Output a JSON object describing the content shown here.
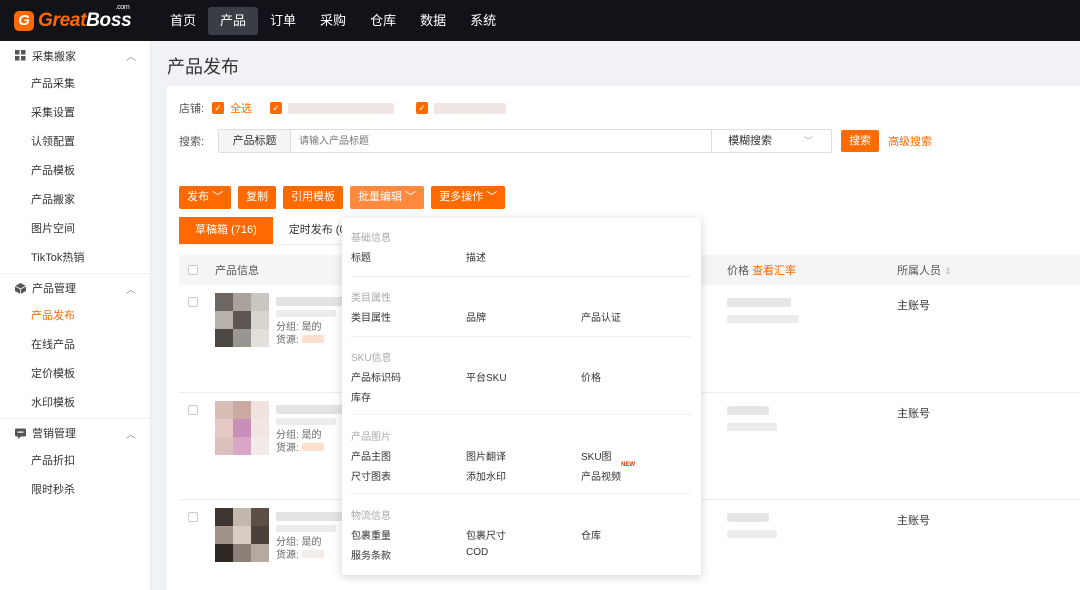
{
  "brand": {
    "logo_mark": "G",
    "name_part1": "Great",
    "name_part2": "Boss",
    "com": ".com"
  },
  "topnav": [
    {
      "label": "首页",
      "active": false
    },
    {
      "label": "产品",
      "active": true
    },
    {
      "label": "订单",
      "active": false
    },
    {
      "label": "采购",
      "active": false
    },
    {
      "label": "仓库",
      "active": false
    },
    {
      "label": "数据",
      "active": false
    },
    {
      "label": "系统",
      "active": false
    }
  ],
  "sidebar": {
    "groups": [
      {
        "label": "采集搬家",
        "icon": "grid-icon",
        "items": [
          "产品采集",
          "采集设置",
          "认领配置",
          "产品模板",
          "产品搬家",
          "图片空间",
          "TikTok热销"
        ]
      },
      {
        "label": "产品管理",
        "icon": "cube-icon",
        "items": [
          "产品发布",
          "在线产品",
          "定价模板",
          "水印模板"
        ]
      },
      {
        "label": "营销管理",
        "icon": "message-icon",
        "items": [
          "产品折扣",
          "限时秒杀"
        ]
      }
    ],
    "active_item": "产品发布"
  },
  "page": {
    "title": "产品发布"
  },
  "filter": {
    "shop_label": "店铺:",
    "select_all": "全选",
    "search_label": "搜索:",
    "search_field": "产品标题",
    "search_placeholder": "请输入产品标题",
    "search_mode": "模糊搜索",
    "search_button": "搜索",
    "advanced_search": "高级搜索"
  },
  "toolbar": {
    "publish": "发布",
    "copy": "复制",
    "use_template": "引用模板",
    "batch_edit": "批量编辑",
    "more_actions": "更多操作"
  },
  "tabs": [
    {
      "label": "草稿箱 (716)",
      "active": true
    },
    {
      "label": "定时发布 (0",
      "active": false
    }
  ],
  "table": {
    "col_product": "产品信息",
    "col_price": "价格",
    "col_price_link": "查看汇率",
    "col_owner": "所属人员",
    "rows": [
      {
        "group_label": "分组:",
        "group_value": "是的",
        "source_label": "货源:",
        "owner": "主账号"
      },
      {
        "group_label": "分组:",
        "group_value": "是的",
        "source_label": "货源:",
        "owner": "主账号"
      },
      {
        "group_label": "分组:",
        "group_value": "是的",
        "source_label": "货源:",
        "owner": "主账号"
      }
    ]
  },
  "batch_menu": {
    "sections": [
      {
        "title": "基础信息",
        "items": [
          "标题",
          "描述"
        ]
      },
      {
        "title": "类目属性",
        "items": [
          "类目属性",
          "品牌",
          "产品认证"
        ]
      },
      {
        "title": "SKU信息",
        "items": [
          "产品标识码",
          "平台SKU",
          "价格",
          "库存"
        ]
      },
      {
        "title": "产品图片",
        "items": [
          "产品主图",
          "图片翻译",
          "SKU图",
          "尺寸图表",
          "添加水印",
          "产品视频"
        ]
      },
      {
        "title": "物流信息",
        "items": [
          "包裹重量",
          "包裹尺寸",
          "仓库",
          "服务条款",
          "COD"
        ]
      }
    ],
    "new_badge": "NEW"
  },
  "colors": {
    "accent": "#ff6a00",
    "topbar": "#111318"
  }
}
